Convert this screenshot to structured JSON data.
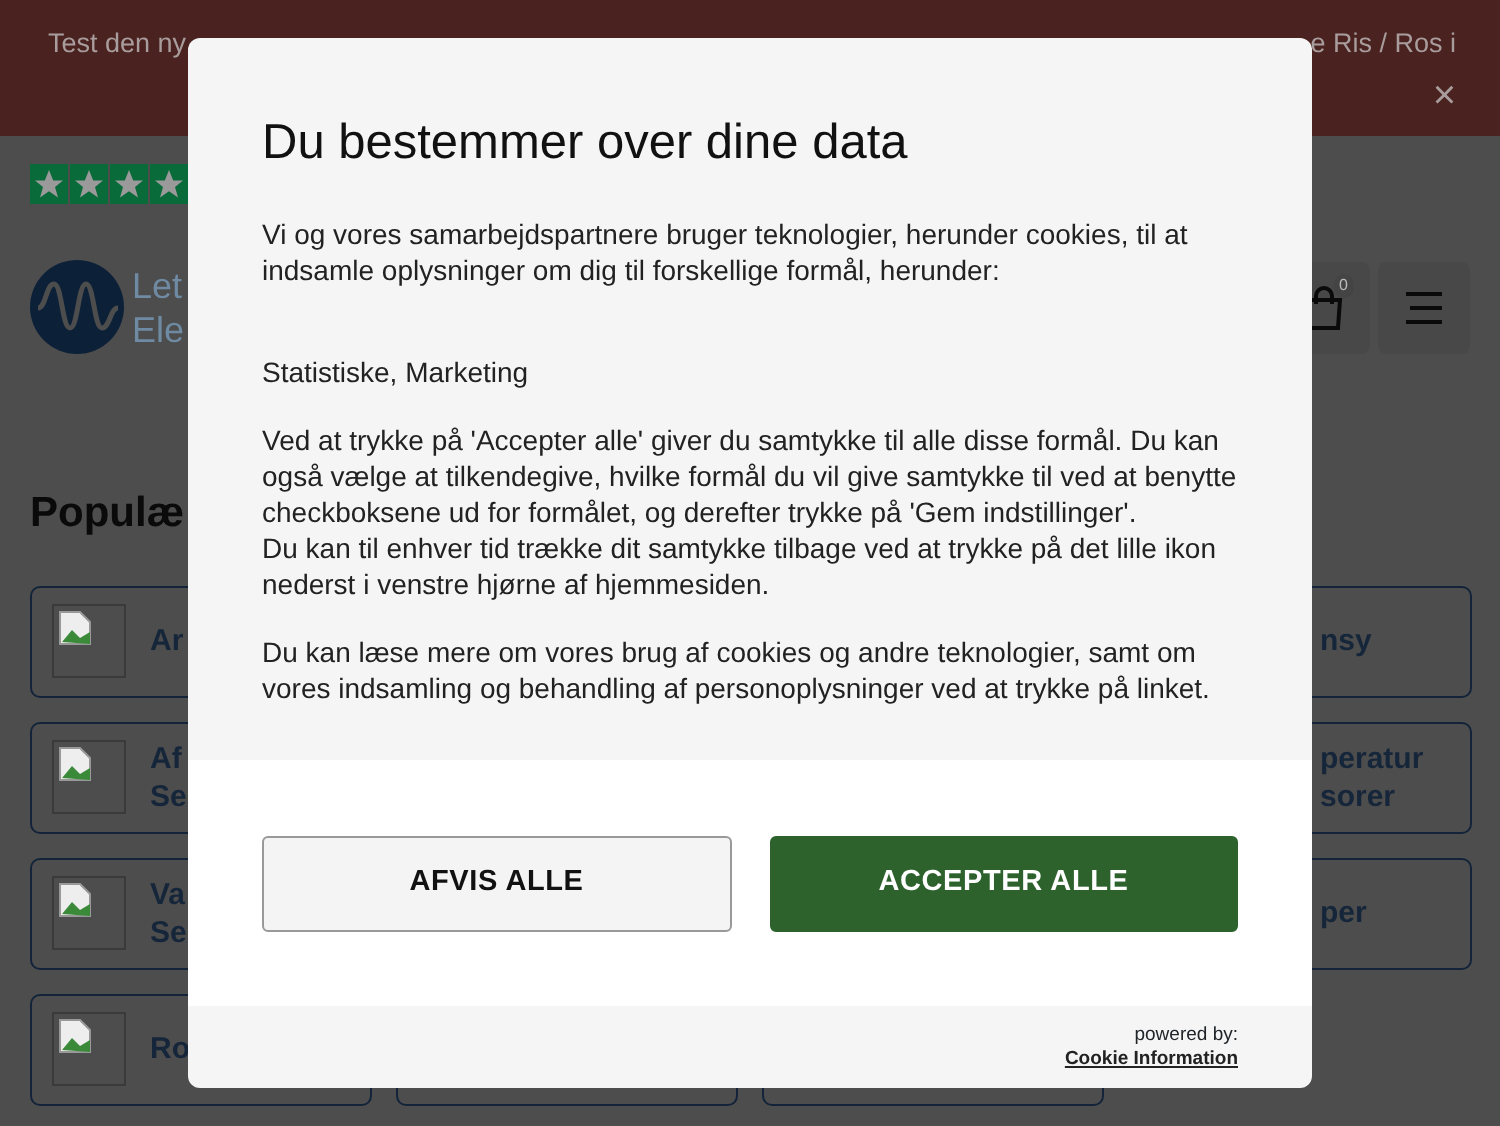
{
  "banner": {
    "text_left": "Test den ny",
    "text_right": "e Ris / Ros i",
    "close": "×"
  },
  "header": {
    "logo_lines": [
      "Let",
      "Ele"
    ],
    "cart_count": "0"
  },
  "heading": "Populæ",
  "card_rows": [
    {
      "cards": [
        {
          "kind": "left",
          "lines": [
            "Ar"
          ]
        },
        {
          "kind": "hidden"
        },
        {
          "kind": "hidden"
        },
        {
          "kind": "right",
          "lines": [
            "nsy"
          ]
        }
      ]
    },
    {
      "cards": [
        {
          "kind": "left",
          "lines": [
            "Af",
            "Se"
          ]
        },
        {
          "kind": "hidden"
        },
        {
          "kind": "hidden"
        },
        {
          "kind": "right",
          "lines": [
            "peratur",
            "sorer"
          ]
        }
      ]
    },
    {
      "cards": [
        {
          "kind": "left",
          "lines": [
            "Va",
            "Se"
          ]
        },
        {
          "kind": "hidden"
        },
        {
          "kind": "hidden"
        },
        {
          "kind": "right",
          "lines": [
            "per"
          ]
        }
      ]
    },
    {
      "cards": [
        {
          "kind": "left",
          "lines": [
            "Ro"
          ]
        },
        {
          "kind": "middle"
        },
        {
          "kind": "middle"
        }
      ]
    }
  ],
  "consent": {
    "title": "Du bestemmer over dine data",
    "paragraphs": [
      {
        "kind": "text",
        "lines": [
          "Vi og vores samarbejdspartnere bruger teknologier, herunder cookies, til at indsamle oplysninger om dig til forskellige formål, herunder:"
        ]
      },
      {
        "kind": "purposes",
        "lines": [
          "Statistiske, Marketing"
        ]
      },
      {
        "kind": "text",
        "lines": [
          "Ved at trykke på 'Accepter alle' giver du samtykke til alle disse formål. Du kan også vælge at tilkendegive, hvilke formål du vil give samtykke til ved at benytte checkboksene ud for formålet, og derefter trykke på 'Gem indstillinger'.",
          "Du kan til enhver tid trække dit samtykke tilbage ved at trykke på det lille ikon nederst i venstre hjørne af hjemmesiden."
        ]
      },
      {
        "kind": "text",
        "lines": [
          "Du kan læse mere om vores brug af cookies og andre teknologier, samt om vores indsamling og behandling af personoplysninger ved at trykke på linket."
        ]
      }
    ],
    "buttons": [
      {
        "label": "AFVIS ALLE",
        "kind": "secondary"
      },
      {
        "label": "ACCEPTER ALLE",
        "kind": "primary"
      }
    ],
    "powered_by": "powered by:",
    "provider_link": "Cookie Information"
  }
}
